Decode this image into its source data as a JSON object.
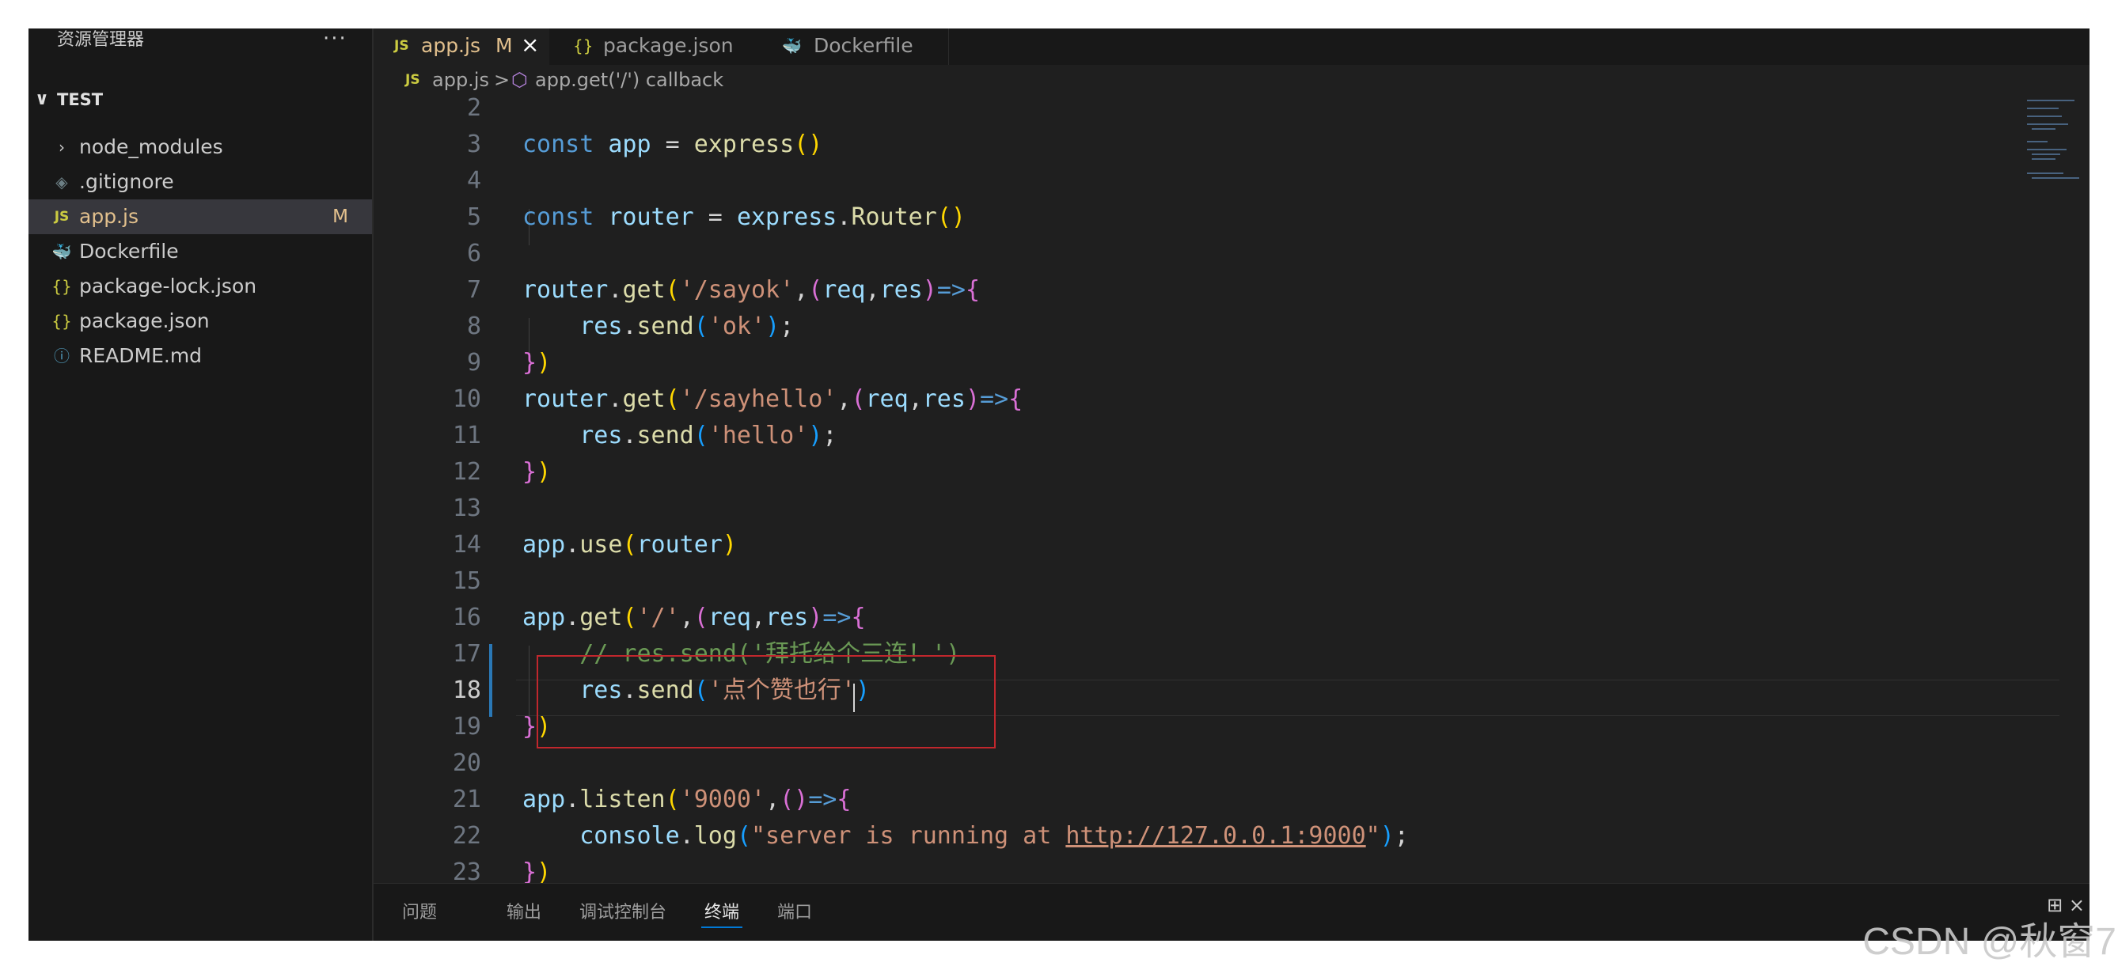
{
  "sidebar": {
    "title": "资源管理器",
    "more": "···",
    "section": {
      "chevron": "∨",
      "name": "TEST"
    },
    "items": [
      {
        "icon": "›",
        "label": "node_modules",
        "badge": ""
      },
      {
        "icon": "◈",
        "label": ".gitignore",
        "badge": ""
      },
      {
        "icon": "JS",
        "label": "app.js",
        "badge": "M"
      },
      {
        "icon": "🐳",
        "label": "Dockerfile",
        "badge": ""
      },
      {
        "icon": "{}",
        "label": "package-lock.json",
        "badge": ""
      },
      {
        "icon": "{}",
        "label": "package.json",
        "badge": ""
      },
      {
        "icon": "ⓘ",
        "label": "README.md",
        "badge": ""
      }
    ]
  },
  "tabs": [
    {
      "icon": "JS",
      "label": "app.js",
      "modified": "M",
      "close": "×"
    },
    {
      "icon": "{}",
      "label": "package.json"
    },
    {
      "icon": "🐳",
      "label": "Dockerfile"
    }
  ],
  "breadcrumb": {
    "file_icon": "JS",
    "file": "app.js",
    "sep": ">",
    "symbol_icon": "⬡",
    "symbol": "app.get('/') callback"
  },
  "editor": {
    "lines": [
      {
        "n": "2",
        "tokens": []
      },
      {
        "n": "3",
        "tokens": [
          [
            "kw",
            "const "
          ],
          [
            "var",
            "app"
          ],
          [
            "op",
            " = "
          ],
          [
            "fn",
            "express"
          ],
          [
            "p1",
            "()"
          ]
        ]
      },
      {
        "n": "4",
        "tokens": []
      },
      {
        "n": "5",
        "tokens": [
          [
            "kw",
            "const "
          ],
          [
            "var",
            "router"
          ],
          [
            "op",
            " = "
          ],
          [
            "var",
            "express"
          ],
          [
            "op",
            "."
          ],
          [
            "fn",
            "Router"
          ],
          [
            "p1",
            "()"
          ]
        ]
      },
      {
        "n": "6",
        "tokens": []
      },
      {
        "n": "7",
        "tokens": [
          [
            "var",
            "router"
          ],
          [
            "op",
            "."
          ],
          [
            "fn",
            "get"
          ],
          [
            "p1",
            "("
          ],
          [
            "str",
            "'/sayok'"
          ],
          [
            "op",
            ","
          ],
          [
            "p2",
            "("
          ],
          [
            "var",
            "req"
          ],
          [
            "op",
            ","
          ],
          [
            "var",
            "res"
          ],
          [
            "p2",
            ")"
          ],
          [
            "kw",
            "=>"
          ],
          [
            "p2",
            "{"
          ]
        ]
      },
      {
        "n": "8",
        "tokens": [
          [
            "op",
            "    "
          ],
          [
            "var",
            "res"
          ],
          [
            "op",
            "."
          ],
          [
            "fn",
            "send"
          ],
          [
            "p3",
            "("
          ],
          [
            "str",
            "'ok'"
          ],
          [
            "p3",
            ")"
          ],
          [
            "op",
            ";"
          ]
        ]
      },
      {
        "n": "9",
        "tokens": [
          [
            "p2",
            "}"
          ],
          [
            "p1",
            ")"
          ]
        ]
      },
      {
        "n": "10",
        "tokens": [
          [
            "var",
            "router"
          ],
          [
            "op",
            "."
          ],
          [
            "fn",
            "get"
          ],
          [
            "p1",
            "("
          ],
          [
            "str",
            "'/sayhello'"
          ],
          [
            "op",
            ","
          ],
          [
            "p2",
            "("
          ],
          [
            "var",
            "req"
          ],
          [
            "op",
            ","
          ],
          [
            "var",
            "res"
          ],
          [
            "p2",
            ")"
          ],
          [
            "kw",
            "=>"
          ],
          [
            "p2",
            "{"
          ]
        ]
      },
      {
        "n": "11",
        "tokens": [
          [
            "op",
            "    "
          ],
          [
            "var",
            "res"
          ],
          [
            "op",
            "."
          ],
          [
            "fn",
            "send"
          ],
          [
            "p3",
            "("
          ],
          [
            "str",
            "'hello'"
          ],
          [
            "p3",
            ")"
          ],
          [
            "op",
            ";"
          ]
        ]
      },
      {
        "n": "12",
        "tokens": [
          [
            "p2",
            "}"
          ],
          [
            "p1",
            ")"
          ]
        ]
      },
      {
        "n": "13",
        "tokens": []
      },
      {
        "n": "14",
        "tokens": [
          [
            "var",
            "app"
          ],
          [
            "op",
            "."
          ],
          [
            "fn",
            "use"
          ],
          [
            "p1",
            "("
          ],
          [
            "var",
            "router"
          ],
          [
            "p1",
            ")"
          ]
        ]
      },
      {
        "n": "15",
        "tokens": []
      },
      {
        "n": "16",
        "tokens": [
          [
            "var",
            "app"
          ],
          [
            "op",
            "."
          ],
          [
            "fn",
            "get"
          ],
          [
            "p1",
            "("
          ],
          [
            "str",
            "'/'"
          ],
          [
            "op",
            ","
          ],
          [
            "p2",
            "("
          ],
          [
            "var",
            "req"
          ],
          [
            "op",
            ","
          ],
          [
            "var",
            "res"
          ],
          [
            "p2",
            ")"
          ],
          [
            "kw",
            "=>"
          ],
          [
            "p2",
            "{"
          ]
        ]
      },
      {
        "n": "17",
        "tokens": [
          [
            "op",
            "    "
          ],
          [
            "cm",
            "// res.send('拜托给个三连！')"
          ]
        ]
      },
      {
        "n": "18",
        "tokens": [
          [
            "op",
            "    "
          ],
          [
            "var",
            "res"
          ],
          [
            "op",
            "."
          ],
          [
            "fn",
            "send"
          ],
          [
            "p3",
            "("
          ],
          [
            "str",
            "'点个赞也行'"
          ],
          [
            "p3",
            ")"
          ]
        ]
      },
      {
        "n": "19",
        "tokens": [
          [
            "p2",
            "}"
          ],
          [
            "p1",
            ")"
          ]
        ]
      },
      {
        "n": "20",
        "tokens": []
      },
      {
        "n": "21",
        "tokens": [
          [
            "var",
            "app"
          ],
          [
            "op",
            "."
          ],
          [
            "fn",
            "listen"
          ],
          [
            "p1",
            "("
          ],
          [
            "str",
            "'9000'"
          ],
          [
            "op",
            ","
          ],
          [
            "p2",
            "()"
          ],
          [
            "kw",
            "=>"
          ],
          [
            "p2",
            "{"
          ]
        ]
      },
      {
        "n": "22",
        "tokens": [
          [
            "op",
            "    "
          ],
          [
            "var",
            "console"
          ],
          [
            "op",
            "."
          ],
          [
            "fn",
            "log"
          ],
          [
            "p3",
            "("
          ],
          [
            "str",
            "\"server is running at "
          ],
          [
            "str link",
            "http://127.0.0.1:9000"
          ],
          [
            "str",
            "\""
          ],
          [
            "p3",
            ")"
          ],
          [
            "op",
            ";"
          ]
        ]
      },
      {
        "n": "23",
        "tokens": [
          [
            "p2",
            "}"
          ],
          [
            "p1",
            ")"
          ]
        ]
      }
    ],
    "current_line": "18"
  },
  "panel": {
    "tabs": [
      "问题",
      "输出",
      "调试控制台",
      "终端",
      "端口"
    ],
    "active": "终端",
    "control": "⊞ ×"
  },
  "watermark": "CSDN @秋窗7"
}
